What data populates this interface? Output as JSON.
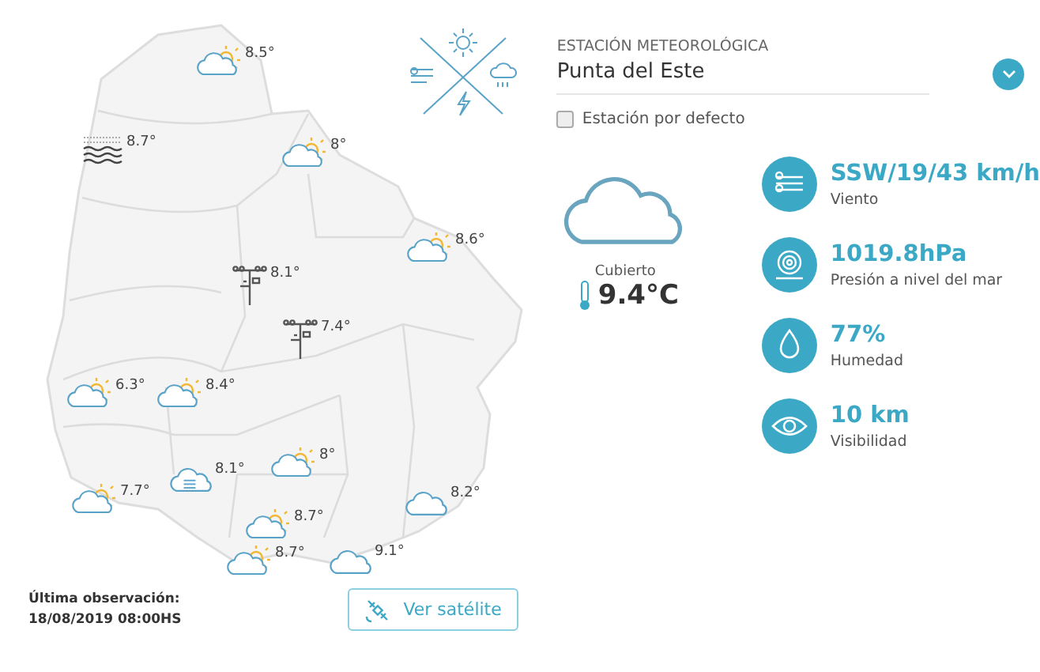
{
  "map": {
    "markers": [
      {
        "kind": "partly",
        "temp": "8.5°"
      },
      {
        "kind": "fog",
        "temp": "8.7°"
      },
      {
        "kind": "partly",
        "temp": "8°"
      },
      {
        "kind": "partly",
        "temp": "8.6°"
      },
      {
        "kind": "station",
        "temp": "8.1°"
      },
      {
        "kind": "station",
        "temp": "7.4°"
      },
      {
        "kind": "partly",
        "temp": "6.3°"
      },
      {
        "kind": "partly",
        "temp": "8.4°"
      },
      {
        "kind": "mist",
        "temp": "8.1°"
      },
      {
        "kind": "partly",
        "temp": "8°"
      },
      {
        "kind": "partly",
        "temp": "7.7°"
      },
      {
        "kind": "cloud",
        "temp": "8.2°"
      },
      {
        "kind": "partly",
        "temp": "8.7°"
      },
      {
        "kind": "partly",
        "temp": "8.7°"
      },
      {
        "kind": "cloud",
        "temp": "9.1°"
      }
    ]
  },
  "last_observation": {
    "label": "Última observación:",
    "value": "18/08/2019 08:00HS"
  },
  "satellite_button": "Ver satélite",
  "station": {
    "label": "ESTACIÓN METEOROLÓGICA",
    "name": "Punta del Este",
    "default_label": "Estación por defecto",
    "default_checked": false
  },
  "current": {
    "condition": "Cubierto",
    "temperature": "9.4°C"
  },
  "stats": [
    {
      "kind": "wind",
      "value": "SSW/19/43 km/h",
      "label": "Viento"
    },
    {
      "kind": "pressure",
      "value": "1019.8hPa",
      "label": "Presión a nivel del mar"
    },
    {
      "kind": "humidity",
      "value": "77%",
      "label": "Humedad"
    },
    {
      "kind": "visibility",
      "value": "10 km",
      "label": "Visibilidad"
    }
  ]
}
